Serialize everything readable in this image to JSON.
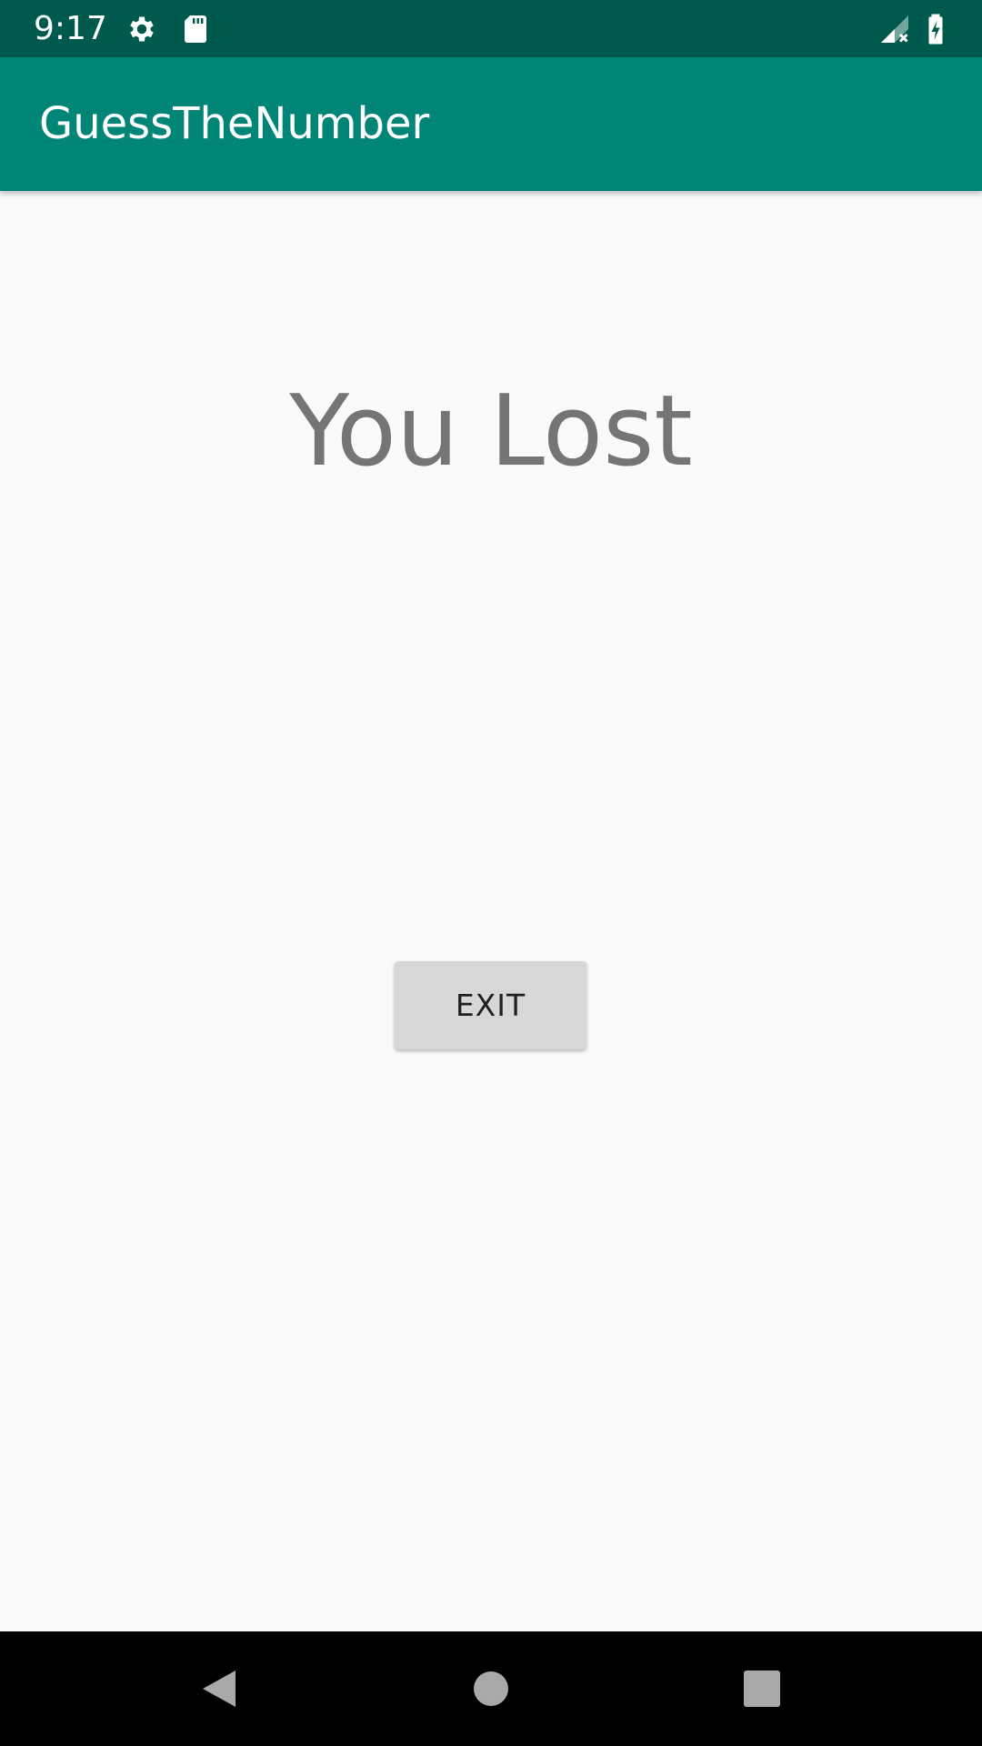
{
  "status_bar": {
    "time": "9:17",
    "icons": [
      "settings-gear-icon",
      "sd-card-icon",
      "signal-no-connection-icon",
      "battery-charging-icon"
    ]
  },
  "app_bar": {
    "title": "GuessTheNumber"
  },
  "main": {
    "result_text": "You Lost",
    "exit_label": "EXIT"
  },
  "nav_bar": {
    "buttons": [
      "back-icon",
      "home-icon",
      "recents-icon"
    ]
  },
  "colors": {
    "status_bar": "#00594d",
    "app_bar": "#008577",
    "background": "#fafafa",
    "result_text": "#757575",
    "button_bg": "#d6d7d7",
    "nav_bar": "#000000"
  }
}
